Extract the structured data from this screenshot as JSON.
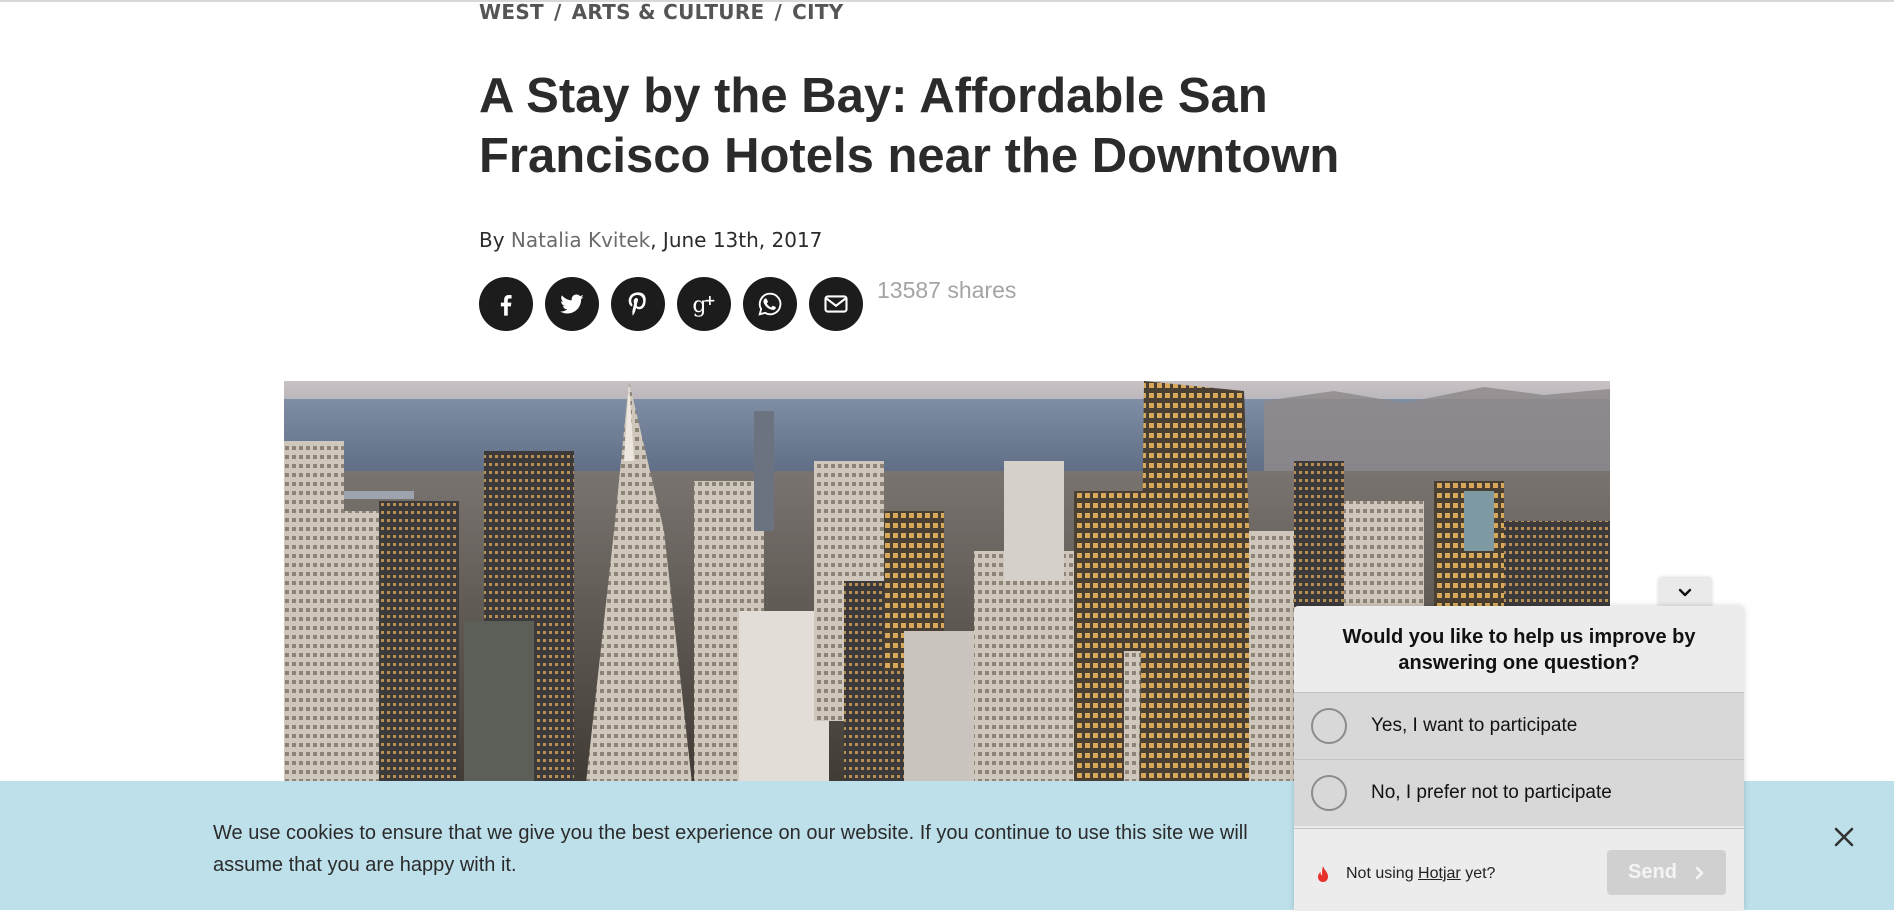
{
  "breadcrumb": {
    "items": [
      "WEST",
      "ARTS & CULTURE",
      "CITY"
    ],
    "separator": "/"
  },
  "article": {
    "title": "A Stay by the Bay: Affordable San Francisco Hotels near the Downtown",
    "by_prefix": "By",
    "author": "Natalia Kvitek",
    "date": ", June 13th, 2017"
  },
  "share": {
    "buttons": [
      "facebook-icon",
      "twitter-icon",
      "pinterest-icon",
      "google-plus-icon",
      "whatsapp-icon",
      "email-icon"
    ],
    "count_text": "13587 shares"
  },
  "cookie_banner": {
    "text": "We use cookies to ensure that we give you the best experience on our website. If you continue to use this site we will assume that you are happy with it.",
    "close_icon": "close-icon"
  },
  "survey": {
    "question": "Would you like to help us improve by answering one question?",
    "options": [
      "Yes, I want to participate",
      "No, I prefer not to participate"
    ],
    "not_using_prefix": "Not using",
    "not_using_link": "Hotjar",
    "not_using_suffix": "yet?",
    "send_label": "Send",
    "colors": {
      "panel": "#ececec",
      "option": "#d8d8d8",
      "send_disabled": "#d0d0d0",
      "flame": "#e8312b"
    }
  },
  "colors": {
    "cookie_bg": "#bde0ea",
    "share_bg": "#1c1c1c",
    "text": "#2b2b2b"
  }
}
